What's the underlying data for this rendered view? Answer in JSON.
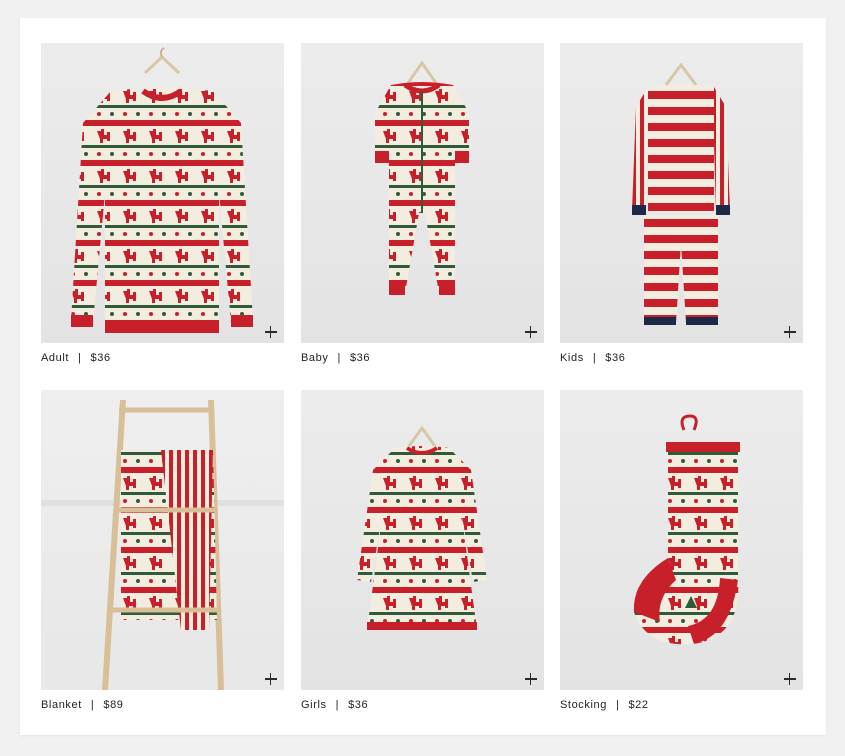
{
  "products": [
    {
      "name": "Adult",
      "price": "$36",
      "image": "adult-pajama-top",
      "action_icon": "plus-icon"
    },
    {
      "name": "Baby",
      "price": "$36",
      "image": "baby-onesie-pajamas",
      "action_icon": "plus-icon"
    },
    {
      "name": "Kids",
      "price": "$36",
      "image": "kids-striped-pajamas",
      "action_icon": "plus-icon"
    },
    {
      "name": "Blanket",
      "price": "$89",
      "image": "blanket-on-ladder",
      "action_icon": "plus-icon"
    },
    {
      "name": "Girls",
      "price": "$36",
      "image": "girls-nightgown",
      "action_icon": "plus-icon"
    },
    {
      "name": "Stocking",
      "price": "$22",
      "image": "knit-stocking",
      "action_icon": "plus-icon"
    }
  ],
  "separator": "|",
  "colors": {
    "red": "#c8202a",
    "cream": "#f3ede0",
    "green": "#2f5b3a",
    "navy": "#1e2847"
  }
}
